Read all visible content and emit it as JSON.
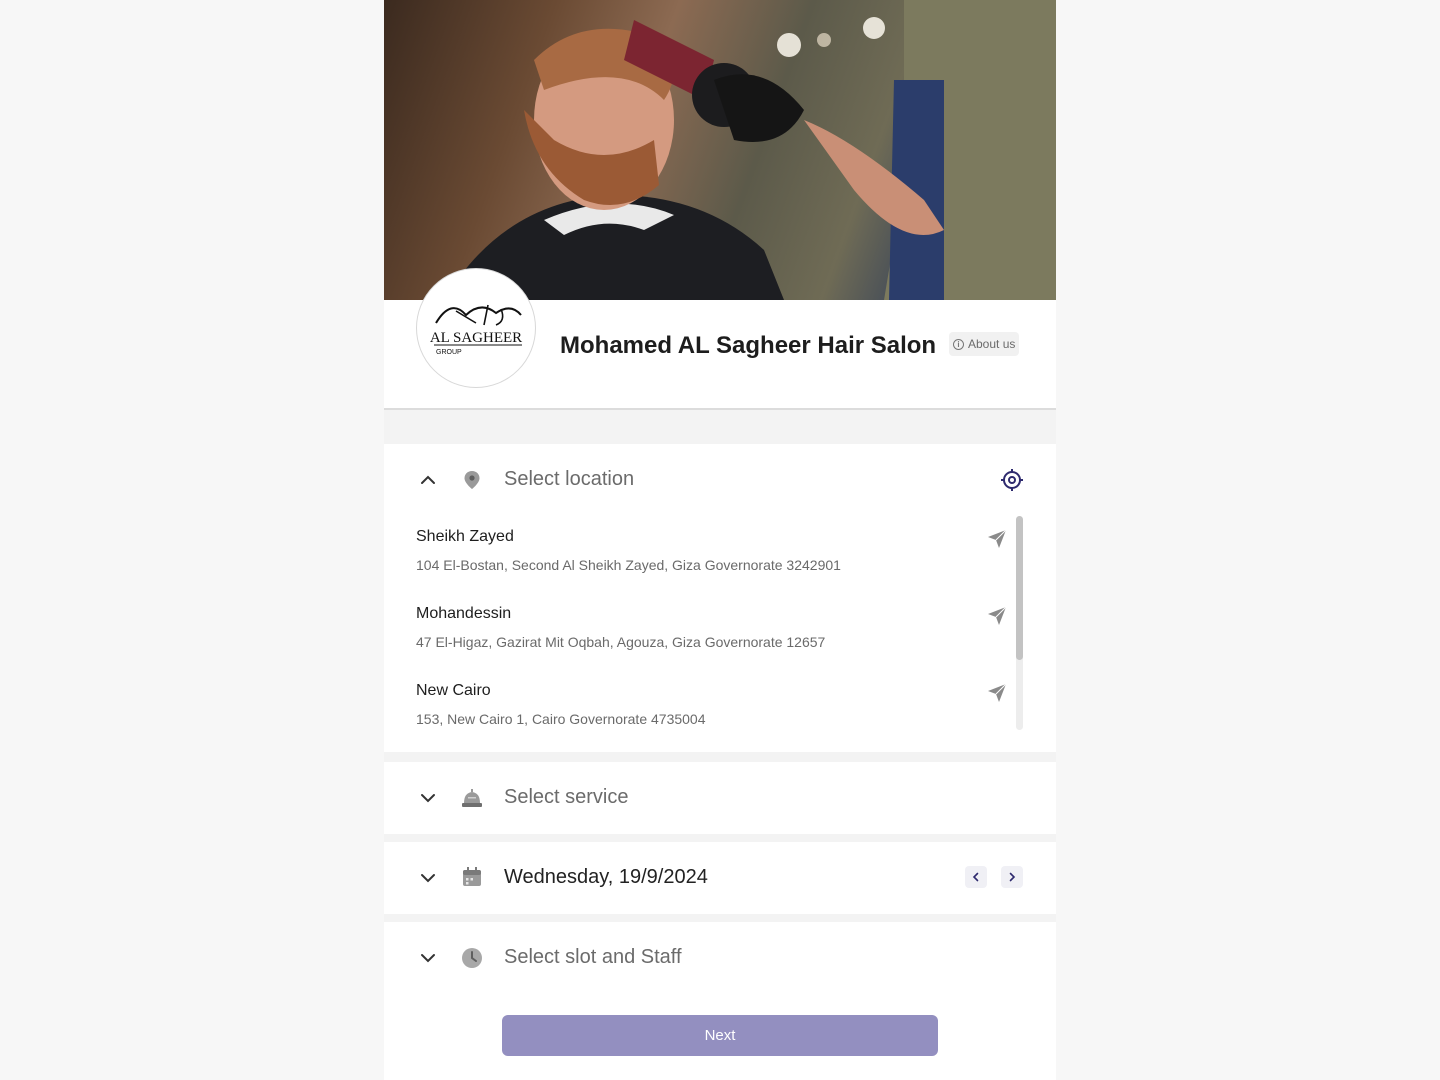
{
  "salon": {
    "name": "Mohamed AL Sagheer Hair Salon",
    "about_label": "About us",
    "logo_text": "AL SAGHEER",
    "logo_subtext": "GROUP"
  },
  "location_section": {
    "title": "Select location",
    "expanded": true,
    "locations": [
      {
        "name": "Sheikh Zayed",
        "address": "104 El-Bostan, Second Al Sheikh Zayed, Giza Governorate 3242901"
      },
      {
        "name": "Mohandessin",
        "address": "47 El-Higaz, Gazirat Mit Oqbah, Agouza, Giza Governorate 12657"
      },
      {
        "name": "New Cairo",
        "address": "153, New Cairo 1, Cairo Governorate 4735004"
      }
    ]
  },
  "service_section": {
    "title": "Select service"
  },
  "date_section": {
    "title": "Wednesday, 19/9/2024"
  },
  "slot_section": {
    "title": "Select slot and Staff"
  },
  "next_button": {
    "label": "Next"
  },
  "colors": {
    "accent": "#2e2a6e",
    "next_button": "#938fc0",
    "icon_gray": "#8a8a8a"
  },
  "icons": {
    "location": "map-pin-icon",
    "service": "service-bell-icon",
    "date": "calendar-icon",
    "slot": "clock-icon",
    "target": "crosshair-icon",
    "navigate": "navigation-arrow-icon"
  }
}
